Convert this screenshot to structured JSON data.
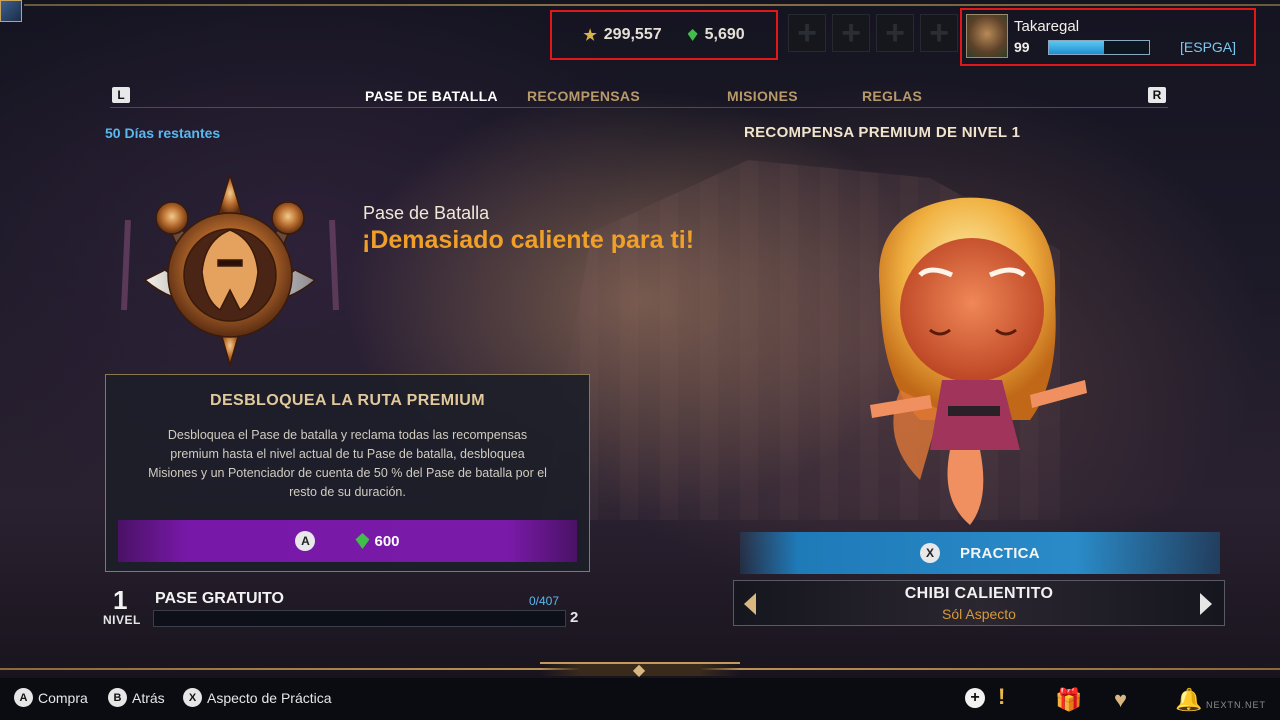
{
  "header": {
    "currencies": [
      {
        "icon": "star-icon",
        "value": "299,557"
      },
      {
        "icon": "gem-icon",
        "value": "5,690"
      }
    ],
    "empty_slots": [
      "+",
      "+",
      "+",
      "+"
    ],
    "profile": {
      "name": "Takaregal",
      "level": "99",
      "xp_fraction": 0.55,
      "tag": "[ESPGA]"
    }
  },
  "tabs": {
    "left_button": "L",
    "right_button": "R",
    "items": [
      {
        "label": "PASE DE BATALLA",
        "active": true
      },
      {
        "label": "RECOMPENSAS",
        "active": false
      },
      {
        "label": "MISIONES",
        "active": false
      },
      {
        "label": "REGLAS",
        "active": false
      }
    ]
  },
  "battle_pass": {
    "days_remaining": "50 Días restantes",
    "subtitle": "Pase de Batalla",
    "title": "¡Demasiado caliente para ti!",
    "premium": {
      "title": "DESBLOQUEA LA RUTA PREMIUM",
      "description": "Desbloquea el Pase de batalla y reclama todas las recompensas premium hasta el nivel actual de tu Pase de batalla, desbloquea Misiones y un Potenciador de cuenta de 50 % del Pase de batalla por el resto de su duración.",
      "button_glyph": "A",
      "price": "600"
    },
    "level": {
      "number": "1",
      "label": "NIVEL",
      "track": "PASE GRATUITO",
      "progress": "0/407",
      "progress_fraction": 0.0,
      "next": "2"
    }
  },
  "reward": {
    "heading": "RECOMPENSA PREMIUM DE NIVEL 1",
    "practice_glyph": "X",
    "practice_label": "PRACTICA",
    "skin_name": "CHIBI CALIENTITO",
    "skin_type": "Sól Aspecto"
  },
  "footer": {
    "hints": [
      {
        "glyph": "A",
        "label": "Compra"
      },
      {
        "glyph": "B",
        "label": "Atrás"
      },
      {
        "glyph": "X",
        "label": "Aspecto de Práctica"
      }
    ],
    "watermark": "NEXTN.NET"
  },
  "colors": {
    "accent_orange": "#f0a028",
    "accent_blue": "#5ab8f0",
    "purchase_purple": "#7818a8",
    "highlight_red": "#e01818"
  }
}
